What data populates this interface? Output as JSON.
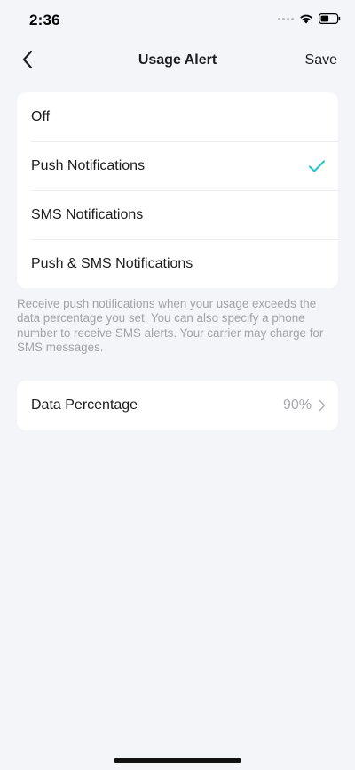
{
  "status_bar": {
    "time": "2:36"
  },
  "nav": {
    "title": "Usage Alert",
    "save_label": "Save",
    "back_icon": "chevron-left-icon"
  },
  "options": [
    {
      "label": "Off",
      "selected": false
    },
    {
      "label": "Push Notifications",
      "selected": true
    },
    {
      "label": "SMS Notifications",
      "selected": false
    },
    {
      "label": "Push & SMS Notifications",
      "selected": false
    }
  ],
  "description": "Receive push notifications when your usage exceeds the data percentage you set. You can also specify a phone number to receive SMS alerts. Your carrier may charge for SMS messages.",
  "data_percentage": {
    "label": "Data Percentage",
    "value": "90%"
  },
  "colors": {
    "accent": "#2ec4c8",
    "background": "#f4f5f9",
    "card": "#ffffff",
    "secondary_text": "#a2a3a8"
  }
}
